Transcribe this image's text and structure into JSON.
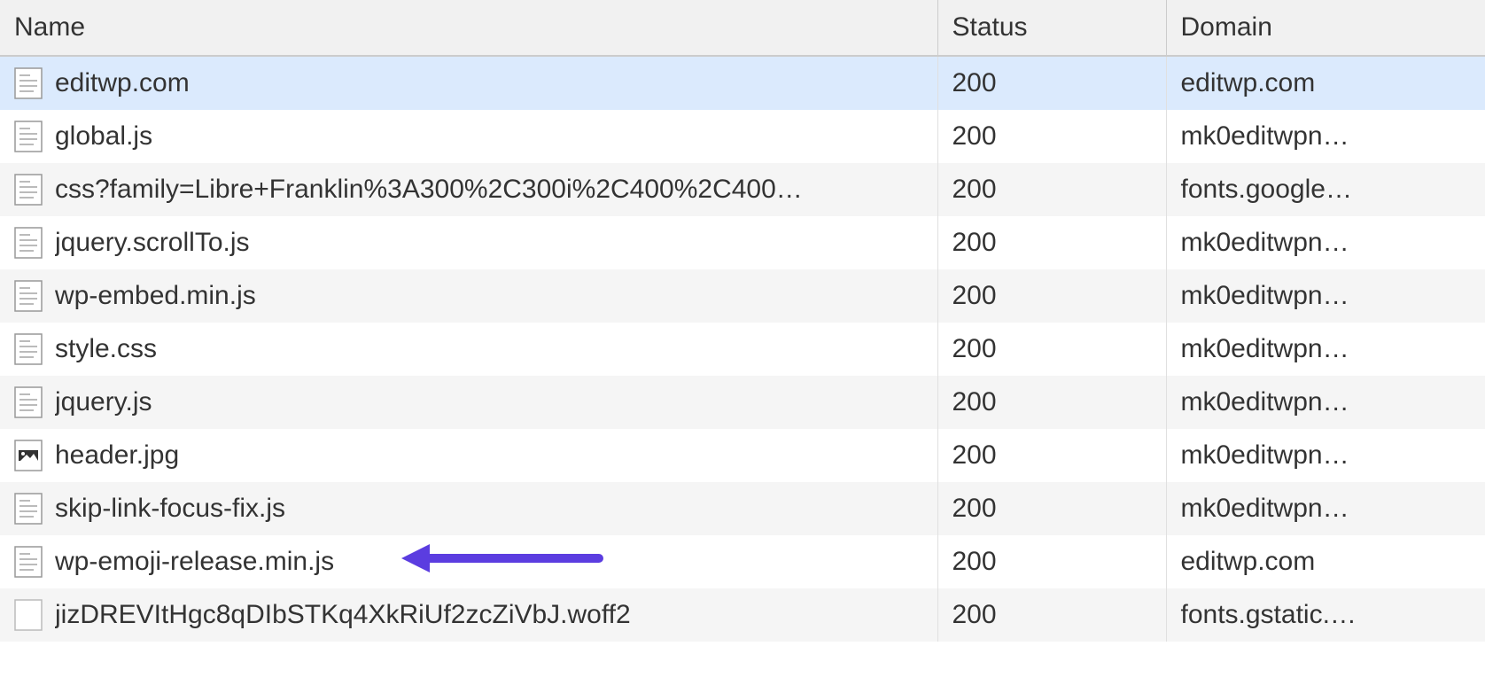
{
  "columns": {
    "name": "Name",
    "status": "Status",
    "domain": "Domain"
  },
  "annotation": {
    "arrow_color": "#5b3de0",
    "target_row_index": 9
  },
  "rows": [
    {
      "name": "editwp.com",
      "status": "200",
      "domain": "editwp.com",
      "icon": "document",
      "selected": true
    },
    {
      "name": "global.js",
      "status": "200",
      "domain": "mk0editwpn…",
      "icon": "document",
      "selected": false
    },
    {
      "name": "css?family=Libre+Franklin%3A300%2C300i%2C400%2C400…",
      "status": "200",
      "domain": "fonts.google…",
      "icon": "document",
      "selected": false
    },
    {
      "name": "jquery.scrollTo.js",
      "status": "200",
      "domain": "mk0editwpn…",
      "icon": "document",
      "selected": false
    },
    {
      "name": "wp-embed.min.js",
      "status": "200",
      "domain": "mk0editwpn…",
      "icon": "document",
      "selected": false
    },
    {
      "name": "style.css",
      "status": "200",
      "domain": "mk0editwpn…",
      "icon": "document",
      "selected": false
    },
    {
      "name": "jquery.js",
      "status": "200",
      "domain": "mk0editwpn…",
      "icon": "document",
      "selected": false
    },
    {
      "name": "header.jpg",
      "status": "200",
      "domain": "mk0editwpn…",
      "icon": "image",
      "selected": false
    },
    {
      "name": "skip-link-focus-fix.js",
      "status": "200",
      "domain": "mk0editwpn…",
      "icon": "document",
      "selected": false
    },
    {
      "name": "wp-emoji-release.min.js",
      "status": "200",
      "domain": "editwp.com",
      "icon": "document",
      "selected": false
    },
    {
      "name": "jizDREVItHgc8qDIbSTKq4XkRiUf2zcZiVbJ.woff2",
      "status": "200",
      "domain": "fonts.gstatic.…",
      "icon": "blank",
      "selected": false
    }
  ]
}
